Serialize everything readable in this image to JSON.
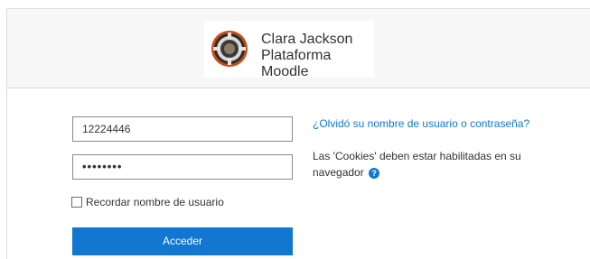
{
  "brand": {
    "line1": "Clara Jackson",
    "line2": "Plataforma Moodle"
  },
  "login": {
    "username_value": "12224446",
    "password_mask": "••••••••",
    "remember_label": "Recordar nombre de usuario",
    "submit_label": "Acceder"
  },
  "help": {
    "forgot_link": "¿Olvidó su nombre de usuario o contraseña?",
    "cookies_text": "Las 'Cookies' deben estar habilitadas en su navegador",
    "help_icon": "question-circle-icon"
  },
  "colors": {
    "accent": "#1177d1",
    "header_bg": "#f7f7f7"
  }
}
